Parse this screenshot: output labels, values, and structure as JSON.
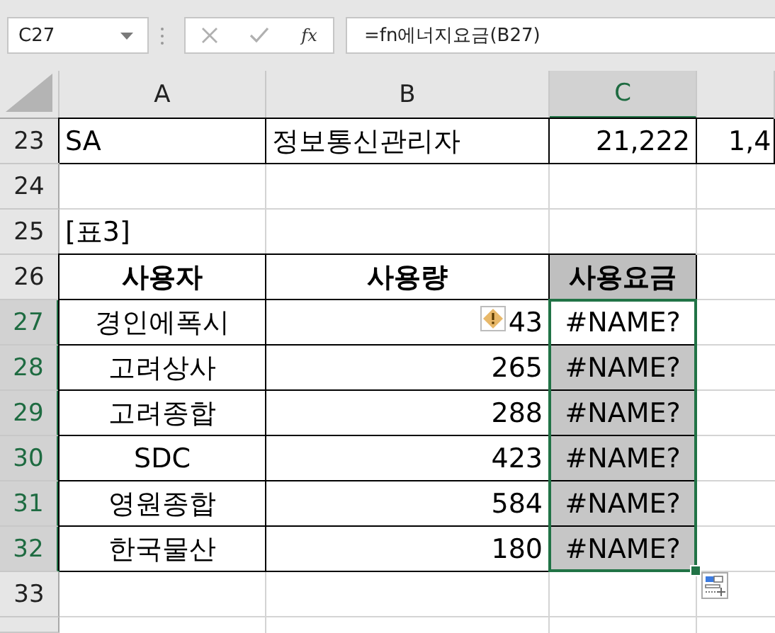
{
  "name_box": {
    "value": "C27"
  },
  "formula_bar": {
    "function_label": "fx",
    "formula": "=fn에너지요금(B27)"
  },
  "columns": [
    {
      "label": "A",
      "selected": false
    },
    {
      "label": "B",
      "selected": false
    },
    {
      "label": "C",
      "selected": true
    }
  ],
  "rows": [
    {
      "number": "23",
      "selected": false,
      "cells": [
        {
          "text": "SA",
          "kind": "label",
          "bordered": true
        },
        {
          "text": "정보통신관리자",
          "kind": "label",
          "bordered": true
        },
        {
          "text": "21,222",
          "kind": "number",
          "bordered": true
        },
        {
          "text": "1,4",
          "kind": "number-cut",
          "bordered": true
        }
      ]
    },
    {
      "number": "24",
      "selected": false,
      "cells": []
    },
    {
      "number": "25",
      "selected": false,
      "cells": [
        {
          "text": "[표3]",
          "kind": "label",
          "bordered": false
        }
      ]
    },
    {
      "number": "26",
      "selected": false,
      "cells": [
        {
          "text": "사용자",
          "kind": "heading",
          "bordered": true
        },
        {
          "text": "사용량",
          "kind": "heading",
          "bordered": true
        },
        {
          "text": "사용요금",
          "kind": "heading",
          "bordered": true,
          "shaded": true
        }
      ]
    },
    {
      "number": "27",
      "selected": true,
      "cells": [
        {
          "text": "경인에폭시",
          "kind": "centered",
          "bordered": true
        },
        {
          "text": "43",
          "kind": "number",
          "bordered": true,
          "warning": true
        },
        {
          "text": "#NAME?",
          "kind": "error",
          "bordered": true,
          "selected": true,
          "active": true
        }
      ]
    },
    {
      "number": "28",
      "selected": true,
      "cells": [
        {
          "text": "고려상사",
          "kind": "centered",
          "bordered": true
        },
        {
          "text": "265",
          "kind": "number",
          "bordered": true
        },
        {
          "text": "#NAME?",
          "kind": "error",
          "bordered": true,
          "selected": true,
          "active": false
        }
      ]
    },
    {
      "number": "29",
      "selected": true,
      "cells": [
        {
          "text": "고려종합",
          "kind": "centered",
          "bordered": true
        },
        {
          "text": "288",
          "kind": "number",
          "bordered": true
        },
        {
          "text": "#NAME?",
          "kind": "error",
          "bordered": true,
          "selected": true,
          "active": false
        }
      ]
    },
    {
      "number": "30",
      "selected": true,
      "cells": [
        {
          "text": "SDC",
          "kind": "centered",
          "bordered": true
        },
        {
          "text": "423",
          "kind": "number",
          "bordered": true
        },
        {
          "text": "#NAME?",
          "kind": "error",
          "bordered": true,
          "selected": true,
          "active": false
        }
      ]
    },
    {
      "number": "31",
      "selected": true,
      "cells": [
        {
          "text": "영원종합",
          "kind": "centered",
          "bordered": true
        },
        {
          "text": "584",
          "kind": "number",
          "bordered": true
        },
        {
          "text": "#NAME?",
          "kind": "error",
          "bordered": true,
          "selected": true,
          "active": false
        }
      ]
    },
    {
      "number": "32",
      "selected": true,
      "cells": [
        {
          "text": "한국물산",
          "kind": "centered",
          "bordered": true
        },
        {
          "text": "180",
          "kind": "number",
          "bordered": true
        },
        {
          "text": "#NAME?",
          "kind": "error",
          "bordered": true,
          "selected": true,
          "active": false
        }
      ]
    },
    {
      "number": "33",
      "selected": false,
      "cells": []
    }
  ]
}
